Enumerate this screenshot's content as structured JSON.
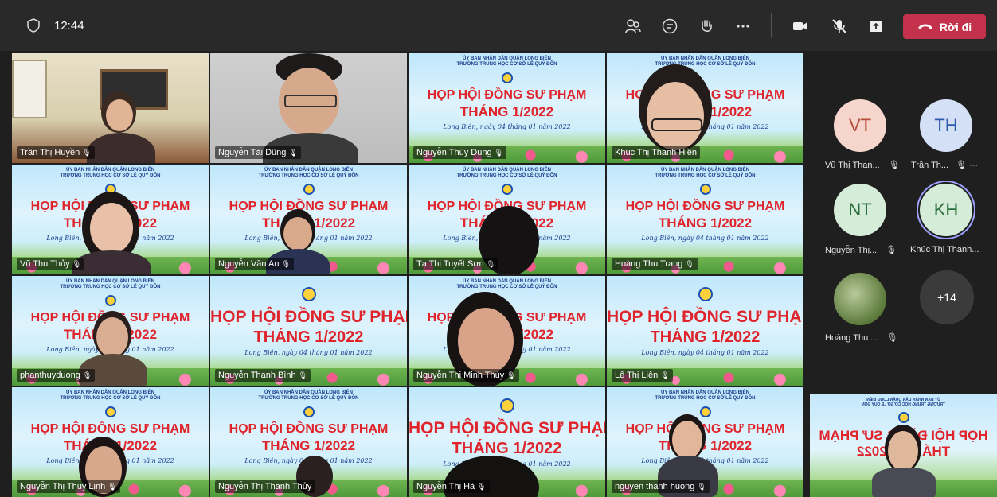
{
  "topbar": {
    "time": "12:44",
    "leave_label": "Rời đi",
    "icons": [
      "shield-icon",
      "participants-icon",
      "chat-icon",
      "raise-hand-icon",
      "more-icon",
      "camera-icon",
      "mic-off-icon",
      "share-icon",
      "phone-icon"
    ]
  },
  "slide": {
    "org_line1": "ỦY BAN NHÂN DÂN QUẬN LONG BIÊN",
    "org_line2": "TRƯỜNG TRUNG HỌC CƠ SỞ LÊ QUÝ ĐÔN",
    "title": "HỌP HỘI ĐỒNG SƯ PHẠM",
    "subtitle": "THÁNG 1/2022",
    "date": "Long Biên, ngày 04 tháng 01 năm 2022"
  },
  "tiles": [
    {
      "name": "Trần Thị Huyền"
    },
    {
      "name": "Nguyễn Tài Dũng"
    },
    {
      "name": "Nguyễn Thùy Dung"
    },
    {
      "name": "Khúc Thị Thanh Hiền"
    },
    {
      "name": "Vũ Thu Thủy"
    },
    {
      "name": "Nguyễn Văn An"
    },
    {
      "name": "Tạ Thị Tuyết Sơn"
    },
    {
      "name": "Hoàng Thu Trang"
    },
    {
      "name": "phanthuyduong"
    },
    {
      "name": "Nguyễn Thanh Bình"
    },
    {
      "name": "Nguyễn Thị Minh Thúy"
    },
    {
      "name": "Lê Thị Liên"
    },
    {
      "name": "Nguyễn Thị Thùy Linh"
    },
    {
      "name": "Nguyễn Thị Thanh Thủy"
    },
    {
      "name": "Nguyễn Thị Hà"
    },
    {
      "name": "nguyen thanh huong"
    }
  ],
  "sidebar": {
    "participants": [
      {
        "initials": "VT",
        "label": "Vũ Thị Than...",
        "color": "#f6d5cd",
        "text_color": "#b34d38"
      },
      {
        "initials": "TH",
        "label": "Trần Th...",
        "color": "#d4e0f5",
        "text_color": "#2e58a8"
      },
      {
        "initials": "NT",
        "label": "Nguyễn Thị...",
        "color": "#d4ecd8",
        "text_color": "#2b6e3b"
      },
      {
        "initials": "KH",
        "label": "Khúc Thị Thanh...",
        "color": "#d4ecd8",
        "text_color": "#2b6e3b"
      },
      {
        "initials": "",
        "label": "Hoàng Thu ...",
        "color": "#7a9a55",
        "text_color": "#ffffff"
      }
    ],
    "overflow_count": "+14"
  }
}
